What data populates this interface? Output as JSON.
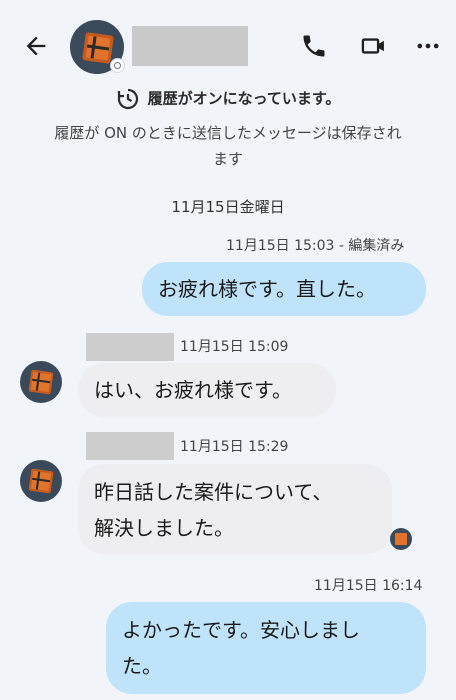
{
  "header": {
    "back_icon": "arrow-left-icon",
    "call_icon": "phone-icon",
    "video_icon": "video-camera-icon",
    "more_icon": "more-horizontal-icon"
  },
  "history": {
    "title": "履歴がオンになっています。",
    "subtitle_line1": "履歴が ON のときに送信したメッセージは保存され",
    "subtitle_line2": "ます"
  },
  "date_separator": "11月15日金曜日",
  "messages": [
    {
      "direction": "out",
      "meta": "11月15日 15:03 - 編集済み",
      "lines": [
        "お疲れ様です。直した。"
      ]
    },
    {
      "direction": "in",
      "meta": "11月15日 15:09",
      "lines": [
        "はい、お疲れ様です。"
      ]
    },
    {
      "direction": "in",
      "meta": "11月15日 15:29",
      "lines": [
        "昨日話した案件について、",
        "解決しました。"
      ]
    },
    {
      "direction": "out",
      "meta": "11月15日 16:14",
      "lines": [
        "よかったです。安心しまし",
        "た。"
      ]
    }
  ],
  "colors": {
    "background": "#f1f5fa",
    "outgoing_bubble": "#bfe3fb",
    "incoming_bubble": "#eeeef0"
  }
}
